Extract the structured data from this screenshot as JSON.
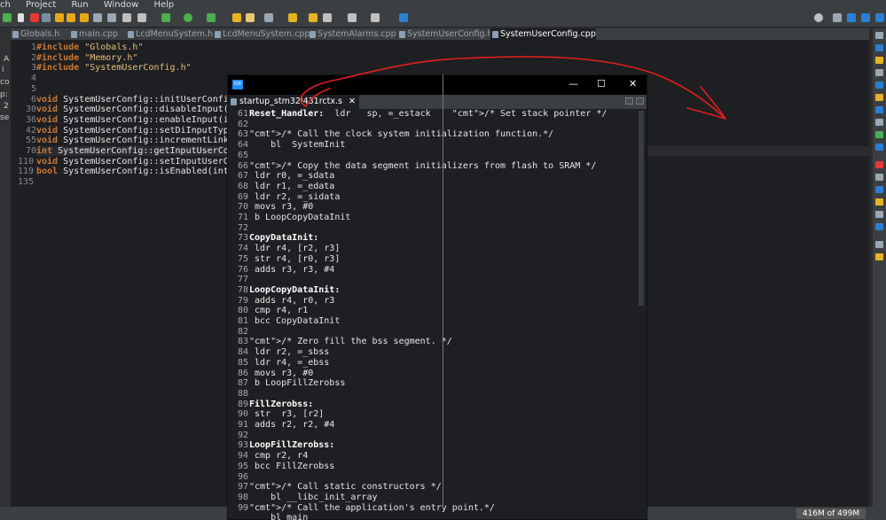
{
  "menubar": {
    "items": [
      "ch",
      "Project",
      "Run",
      "Window",
      "Help"
    ]
  },
  "left_strip": {
    "labels": [
      "A",
      "i",
      "co",
      "p:",
      "2",
      "se"
    ]
  },
  "editor": {
    "tabs": [
      {
        "label": "Globals.h",
        "active": false
      },
      {
        "label": "main.cpp",
        "active": false
      },
      {
        "label": "LcdMenuSystem.h",
        "active": false
      },
      {
        "label": "LcdMenuSystem.cpp",
        "active": false
      },
      {
        "label": "SystemAlarms.cpp",
        "active": false
      },
      {
        "label": "SystemUserConfig.h",
        "active": false
      },
      {
        "label": "SystemUserConfig.cpp",
        "active": true
      }
    ],
    "lines": [
      {
        "n": "1",
        "text": "#include \"Globals.h\""
      },
      {
        "n": "2",
        "text": "#include \"Memory.h\""
      },
      {
        "n": "3",
        "text": "#include \"SystemUserConfig.h\""
      },
      {
        "n": "4",
        "text": ""
      },
      {
        "n": "5",
        "text": ""
      },
      {
        "n": "6",
        "text": "void SystemUserConfig::initUserConfig(voi"
      },
      {
        "n": "30",
        "text": "void SystemUserConfig::disableInput(int i"
      },
      {
        "n": "36",
        "text": "void SystemUserConfig::enableInput(int sy"
      },
      {
        "n": "42",
        "text": "void SystemUserConfig::setDiInputType(int"
      },
      {
        "n": "55",
        "text": "void SystemUserConfig::incrementLinkedSo"
      },
      {
        "n": "70",
        "text": "int SystemUserConfig::getInputUserConfig"
      },
      {
        "n": "110",
        "text": "void SystemUserConfig::setInputUserConfig"
      },
      {
        "n": "119",
        "text": "bool SystemUserConfig::isEnabled(int syst"
      },
      {
        "n": "135",
        "text": ""
      }
    ]
  },
  "popup": {
    "window_controls": {
      "minimize": "—",
      "maximize": "☐",
      "close": "✕"
    },
    "logo_text": "IDE",
    "tab_label": "startup_stm32l431rctx.s",
    "tab_close": "✕",
    "lines": [
      {
        "n": "61",
        "text": "Reset_Handler:  ldr   sp, =_estack    /* Set stack pointer */"
      },
      {
        "n": "62",
        "text": ""
      },
      {
        "n": "63",
        "text": "/* Call the clock system initialization function.*/"
      },
      {
        "n": "64",
        "text": "    bl  SystemInit"
      },
      {
        "n": "65",
        "text": ""
      },
      {
        "n": "66",
        "text": "/* Copy the data segment initializers from flash to SRAM */"
      },
      {
        "n": "67",
        "text": " ldr r0, =_sdata"
      },
      {
        "n": "68",
        "text": " ldr r1, =_edata"
      },
      {
        "n": "69",
        "text": " ldr r2, =_sidata"
      },
      {
        "n": "70",
        "text": " movs r3, #0"
      },
      {
        "n": "71",
        "text": " b LoopCopyDataInit"
      },
      {
        "n": "72",
        "text": ""
      },
      {
        "n": "73",
        "text": "CopyDataInit:"
      },
      {
        "n": "74",
        "text": " ldr r4, [r2, r3]"
      },
      {
        "n": "75",
        "text": " str r4, [r0, r3]"
      },
      {
        "n": "76",
        "text": " adds r3, r3, #4"
      },
      {
        "n": "77",
        "text": ""
      },
      {
        "n": "78",
        "text": "LoopCopyDataInit:"
      },
      {
        "n": "79",
        "text": " adds r4, r0, r3"
      },
      {
        "n": "80",
        "text": " cmp r4, r1"
      },
      {
        "n": "81",
        "text": " bcc CopyDataInit"
      },
      {
        "n": "82",
        "text": ""
      },
      {
        "n": "83",
        "text": "/* Zero fill the bss segment. */"
      },
      {
        "n": "84",
        "text": " ldr r2, =_sbss"
      },
      {
        "n": "85",
        "text": " ldr r4, =_ebss"
      },
      {
        "n": "86",
        "text": " movs r3, #0"
      },
      {
        "n": "87",
        "text": " b LoopFillZerobss"
      },
      {
        "n": "88",
        "text": ""
      },
      {
        "n": "89",
        "text": "FillZerobss:"
      },
      {
        "n": "90",
        "text": " str  r3, [r2]"
      },
      {
        "n": "91",
        "text": " adds r2, r2, #4"
      },
      {
        "n": "92",
        "text": ""
      },
      {
        "n": "93",
        "text": "LoopFillZerobss:"
      },
      {
        "n": "94",
        "text": " cmp r2, r4"
      },
      {
        "n": "95",
        "text": " bcc FillZerobss"
      },
      {
        "n": "96",
        "text": ""
      },
      {
        "n": "97",
        "text": "/* Call static constructors */"
      },
      {
        "n": "98",
        "text": "    bl __libc_init_array"
      },
      {
        "n": "99",
        "text": "/* Call the application's entry point.*/"
      },
      {
        "n": "",
        "text": "    bl main"
      }
    ]
  },
  "status": {
    "memory": "416M of 499M"
  },
  "colors": {
    "annotation_arrow": "#e0201c",
    "comment": "#b5c43a",
    "string": "#e5c07b",
    "keyword": "#cc7832"
  }
}
